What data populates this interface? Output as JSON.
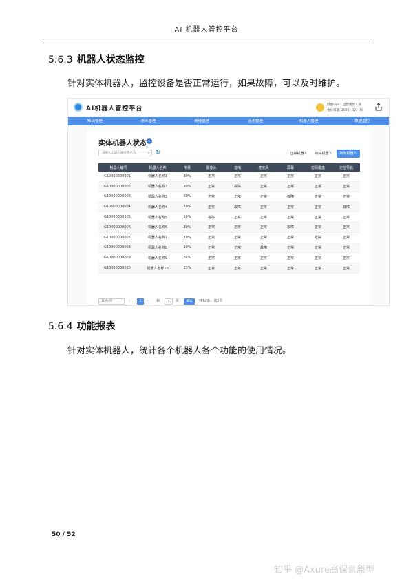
{
  "header": {
    "title": "AI 机器人管控平台"
  },
  "section1": {
    "number": "5.6.3",
    "title": "机器人状态监控",
    "text": "针对实体机器人，监控设备是否正常运行，如果故障，可以及时维护。"
  },
  "app": {
    "title": "AI机器人管控平台",
    "user_line1": "何德vigo | 运营管理人员",
    "user_line2": "会计日期: 2020 - 12 - 16",
    "nav": [
      "知识管理",
      "语义管理",
      "情绪管理",
      "话术管理",
      "机器人管理",
      "数据监控"
    ],
    "card_title": "实体机器人状态",
    "search_placeholder": "请输入机器人编号或名称",
    "filters": [
      "正常机器人",
      "故障机器人",
      "所有机器人"
    ],
    "table": {
      "headers": [
        "机器人编号",
        "机器人名称",
        "电量",
        "摄像头",
        "音响",
        "麦克风",
        "屏幕",
        "密码键盘",
        "定位导航"
      ],
      "rows": [
        [
          "G10000000001",
          "机器人名称1",
          "80%",
          "正常",
          "正常",
          "正常",
          "正常",
          "正常",
          "正常"
        ],
        [
          "G10000000002",
          "机器人名称2",
          "90%",
          "正常",
          "故障",
          "正常",
          "正常",
          "正常",
          "正常"
        ],
        [
          "G10000000003",
          "机器人名称3",
          "60%",
          "正常",
          "正常",
          "正常",
          "故障",
          "正常",
          "正常"
        ],
        [
          "G10000000004",
          "机器人名称4",
          "70%",
          "正常",
          "故障",
          "正常",
          "正常",
          "正常",
          "故障"
        ],
        [
          "G10000000005",
          "机器人名称5",
          "50%",
          "故障",
          "正常",
          "正常",
          "正常",
          "正常",
          "正常"
        ],
        [
          "G10000000006",
          "机器人名称6",
          "30%",
          "正常",
          "正常",
          "正常",
          "故障",
          "正常",
          "正常"
        ],
        [
          "G10000000007",
          "机器人名称7",
          "20%",
          "正常",
          "正常",
          "正常",
          "正常",
          "故障",
          "正常"
        ],
        [
          "G10000000008",
          "机器人名称8",
          "10%",
          "正常",
          "正常",
          "故障",
          "正常",
          "正常",
          "正常"
        ],
        [
          "G10000000009",
          "机器人名称9",
          "34%",
          "正常",
          "正常",
          "正常",
          "正常",
          "正常",
          "正常"
        ],
        [
          "G10000000010",
          "机器人名称10",
          "13%",
          "正常",
          "正常",
          "正常",
          "正常",
          "正常",
          "正常"
        ]
      ]
    },
    "pager": {
      "page_size": "10条/页",
      "current": "1",
      "goto_prefix": "第",
      "goto_value": "1",
      "goto_suffix": "页",
      "confirm": "确认",
      "total": "共12条，共2页"
    }
  },
  "section2": {
    "number": "5.6.4",
    "title": "功能报表",
    "text": "针对实体机器人，统计各个机器人各个功能的使用情况。"
  },
  "footer": {
    "page": "50 / 52"
  },
  "watermark": "知乎 @Axure高保真原型",
  "colors": {
    "accent": "#4c8ee8",
    "table_header": "#3c4a5c",
    "fault": "#e53935"
  }
}
